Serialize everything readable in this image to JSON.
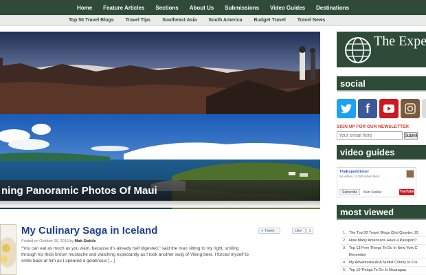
{
  "topnav": [
    "Home",
    "Feature Articles",
    "Sections",
    "About Us",
    "Submissions",
    "Video Guides",
    "Destinations"
  ],
  "subnav": [
    "Top 50 Travel Blogs",
    "Travel Tips",
    "Southeast Asia",
    "South America",
    "Budget Travel",
    "Travel News"
  ],
  "hero": {
    "caption": "ning Panoramic Photos Of Maui"
  },
  "article": {
    "title": "My Culinary Saga in Iceland",
    "meta_prefix": "Posted on October 06, 2013 by",
    "author": "Matt Stabile",
    "excerpt": "“You can eat as much as you want, because it’s already half digested,” said the man sitting to my right, smiling through his thick brown mustache and watching expectantly as I took another swig of Viking beer. I forced myself to smile back at him as I speared a gelatinous […]",
    "tweet_label": "Tweet",
    "like_label": "Like",
    "like_count": "1"
  },
  "sidebar": {
    "logo_text": "The Expedit",
    "social_heading": "social",
    "social_icons": [
      "twitter-icon",
      "facebook-icon",
      "youtube-icon",
      "instagram-icon"
    ],
    "newsletter_label": "SIGN UP FOR OUR NEWSLETTER",
    "email_placeholder": "Your email here",
    "submit_label": "Submit",
    "video_heading": "video guides",
    "yt_channel": "TheExpeditioner",
    "yt_stats": "54 videos | 1,380 subscribers",
    "yt_subscribe": "Subscribe",
    "yt_user": "Matt Stabile",
    "yt_logo": "YouTube",
    "most_viewed_heading": "most viewed",
    "most_viewed": [
      {
        "num": "1.",
        "title": "The Top 50 Travel Blogs (2nd Quarter: 20"
      },
      {
        "num": "2.",
        "title": "How Many Americans Have a Passport?"
      },
      {
        "num": "3.",
        "title": "Top 13 Free Things To Do In New York C"
      },
      {
        "num": "",
        "title": "December"
      },
      {
        "num": "4.",
        "title": "My Adventures At A Nudist Colony In Fra"
      },
      {
        "num": "5.",
        "title": "Top 10 Things To Do In Nicaragua"
      }
    ]
  },
  "colors": {
    "nav_green": "#2f4a39",
    "link_blue": "#1d3f8c",
    "newsletter_red": "#d23a2a"
  }
}
